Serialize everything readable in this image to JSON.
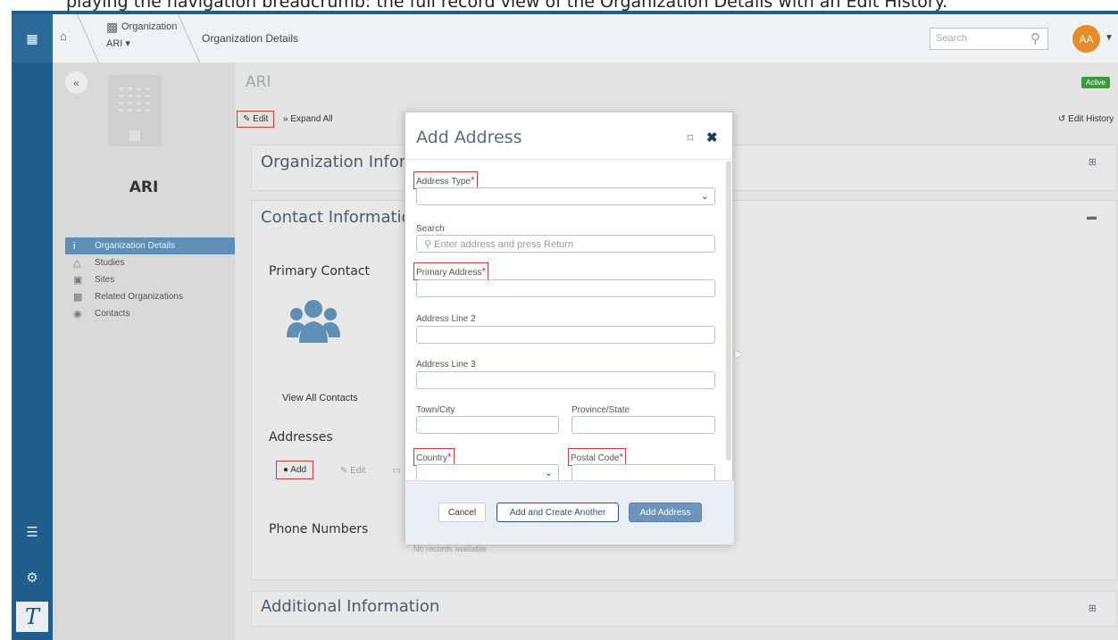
{
  "caption": "playing the navigation breadcrumb: the full record view of the Organization Details with an Edit History.",
  "topbar": {
    "org_label": "Organization",
    "org_value": "ARI",
    "page_crumb": "Organization Details",
    "search_placeholder": "Search",
    "user_initials": "AA"
  },
  "sidebar": {
    "title": "ARI",
    "items": [
      {
        "label": "Organization Details",
        "icon": "info-icon"
      },
      {
        "label": "Studies",
        "icon": "flask-icon"
      },
      {
        "label": "Sites",
        "icon": "site-icon"
      },
      {
        "label": "Related Organizations",
        "icon": "building-icon"
      },
      {
        "label": "Contacts",
        "icon": "people-icon"
      }
    ]
  },
  "main": {
    "title": "ARI",
    "status": "Active",
    "edit": "Edit",
    "expand_all": "Expand All",
    "edit_history": "Edit History",
    "sections": {
      "org_info": "Organization Information",
      "contact": "Contact Information",
      "additional": "Additional Information"
    },
    "primary_contact": "Primary Contact",
    "view_all": "View All Contacts",
    "addresses": "Addresses",
    "add": "Add",
    "edit_small": "Edit",
    "phone_numbers": "Phone Numbers",
    "no_records": "No records available"
  },
  "modal": {
    "title": "Add Address",
    "fields": {
      "address_type": "Address Type",
      "search": "Search",
      "search_placeholder": "Enter address and press Return",
      "primary_address": "Primary Address",
      "line2": "Address Line 2",
      "line3": "Address Line 3",
      "town": "Town/City",
      "province": "Province/State",
      "country": "Country",
      "postal": "Postal Code",
      "required_mark": "*"
    },
    "buttons": {
      "cancel": "Cancel",
      "add_another": "Add and Create Another",
      "add_address": "Add Address"
    }
  },
  "colors": {
    "rail": "#1f5e8e",
    "accent": "#6e94bb",
    "highlight": "#d23a3a",
    "active_badge": "#3e9c40"
  }
}
